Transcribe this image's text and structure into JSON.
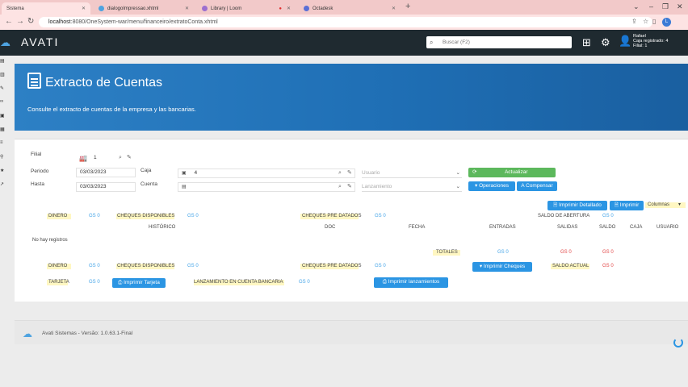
{
  "browser": {
    "tabs": [
      {
        "label": "Sistema"
      },
      {
        "label": "dialogoImpressao.xhtml"
      },
      {
        "label": "Library | Loom"
      },
      {
        "label": "Octadesk"
      }
    ],
    "url_host": "localhost",
    "url_rest": ":8080/OneSystem-war/menu/financeiro/extratoConta.xhtml",
    "profile_initial": "L"
  },
  "app": {
    "logo": "AVATI",
    "search_placeholder": "Buscar (F2)",
    "user_name": "Rafael",
    "user_caja": "Caja registrado: 4",
    "user_filial": "Filial: 1"
  },
  "banner": {
    "title": "Extracto de Cuentas",
    "subtitle": "Consulte el extracto de cuentas de la empresa y las bancarias."
  },
  "form": {
    "filial_label": "Filial",
    "filial_value": "1",
    "periodo_label": "Periodo",
    "periodo_value": "03/03/2023",
    "hasta_label": "Hasta",
    "hasta_value": "03/03/2023",
    "caja_label": "Caja",
    "caja_value": "4",
    "cuenta_label": "Cuenta",
    "usuario_placeholder": "Usuario",
    "lanzamiento_placeholder": "Lanzamiento",
    "actualizar": "Actualizar",
    "operaciones": "Operaciones",
    "a_compensar": "A Compensar",
    "imprimir_detallado": "Imprimir Detallado",
    "imprimir": "Imprimir",
    "columnas": "Columnas"
  },
  "summary_top": {
    "dinero": "DINERO",
    "dinero_val": "GS 0",
    "cheques_disp": "CHEQUES DISPONIBLES",
    "cheques_disp_val": "GS 0",
    "cheques_pre": "CHEQUES PRE DATADOS",
    "cheques_pre_val": "GS 0",
    "saldo_apertura": "SALDO DE ABERTURA",
    "saldo_apertura_val": "GS 0"
  },
  "table": {
    "headers": [
      "HISTÓRICO",
      "DOC",
      "FECHA",
      "ENTRADAS",
      "SALIDAS",
      "SALDO",
      "CAJA",
      "USUARIO"
    ],
    "empty": "No hay registros",
    "totales": "TOTALES",
    "tot_entradas": "GS 0",
    "tot_salidas": "GS 0",
    "tot_saldo": "GS 0"
  },
  "summary_bottom": {
    "dinero": "DINERO",
    "dinero_val": "GS 0",
    "cheques_disp": "CHEQUES DISPONIBLES",
    "cheques_disp_val": "GS 0",
    "cheques_pre": "CHEQUES PRE DATADOS",
    "cheques_pre_val": "GS 0",
    "imprimir_cheques": "Imprimir Cheques",
    "saldo_actual": "SALDO ACTUAL",
    "saldo_actual_val": "GS 0",
    "tarjeta": "TARJETA",
    "tarjeta_val": "GS 0",
    "imprimir_tarjeta": "Imprimir Tarjeta",
    "lanz_cuenta": "LANZAMIENTO EN CUENTA BANCARIA",
    "lanz_cuenta_val": "GS 0",
    "imprimir_lanz": "Imprimir lanzamientos"
  },
  "footer": {
    "version": "Avati Sistemas - Versão: 1.0.63.1-Final"
  },
  "colors": {
    "brand_blue": "#2b95e3",
    "header_dark": "#1f2a30",
    "value_blue": "#45a5e8",
    "value_red": "#e24545",
    "action_green": "#5cb85c"
  }
}
